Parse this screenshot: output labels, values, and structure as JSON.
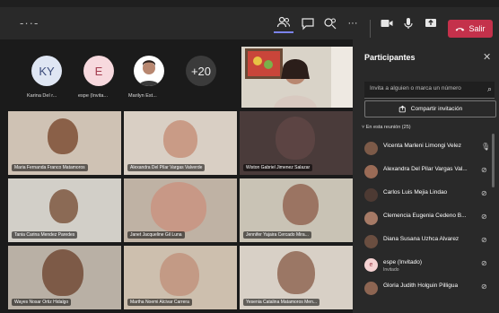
{
  "meeting": {
    "leave_label": "Salir",
    "topbar_more": "···"
  },
  "stage": {
    "avatars": [
      {
        "initials": "KY",
        "name": "Karina Del r...",
        "bg": "#dfe6f3",
        "fg": "#3b4b7a"
      },
      {
        "initials": "E",
        "name": "espe (Invita...",
        "bg": "#f7d9de",
        "fg": "#a33d4f"
      },
      {
        "initials": "",
        "name": "Marilyn Est...",
        "bg": "#ffffff",
        "fg": "#333"
      }
    ],
    "more_count": "+20",
    "tiles": [
      {
        "name": "Maria Fernanda Franco Matamoros",
        "bg": "#cfc2b4",
        "face": "#8a6048"
      },
      {
        "name": "Alexandra Del Pilar Vargas Valverde",
        "bg": "#d9cfc4",
        "face": "#c99b86"
      },
      {
        "name": "Wiston Gabriel Jimenez Salazar",
        "bg": "#4a3b3a",
        "face": "#5c4443"
      },
      {
        "name": "Tania Carina Mendez Paredes",
        "bg": "#d2cfc8",
        "face": "#8b6a55"
      },
      {
        "name": "Janet Jacqueline Gil Luna",
        "bg": "#bfb2a4",
        "face": "#c89886"
      },
      {
        "name": "Jennifer Yajaira Cercado Mira...",
        "bg": "#c9c3b5",
        "face": "#9b7462"
      },
      {
        "name": "Wayes Nosar Ortiz Hidalgo",
        "bg": "#b9b0a5",
        "face": "#7d5a47"
      },
      {
        "name": "Martha Noemi Alcivar Carrera",
        "bg": "#cdbfae",
        "face": "#c39a85"
      },
      {
        "name": "Yesenia Catalina Matamoros Men...",
        "bg": "#d8d0c6",
        "face": "#9b7765"
      }
    ]
  },
  "panel": {
    "title": "Participantes",
    "search_placeholder": "Invita a alguien o marca un número",
    "share_label": "Compartir invitación",
    "section_label": "En esta reunión (25)",
    "participants": [
      {
        "name": "Vicenta Marleni Limongi Velez",
        "sub": "",
        "initial": "",
        "mic": "on"
      },
      {
        "name": "Alexandra Del Pilar Vargas Val...",
        "sub": "",
        "initial": "",
        "mic": "off"
      },
      {
        "name": "Carlos Luis Mejia Lindao",
        "sub": "",
        "initial": "",
        "mic": "off"
      },
      {
        "name": "Clemencia Eugenia Cedeno B...",
        "sub": "",
        "initial": "",
        "mic": "off"
      },
      {
        "name": "Diana Susana Uzhca Alvarez",
        "sub": "",
        "initial": "",
        "mic": "off"
      },
      {
        "name": "espe (Invitado)",
        "sub": "Invitado",
        "initial": "e",
        "mic": "off"
      },
      {
        "name": "Gloria Judith Holguin Pilligua",
        "sub": "",
        "initial": "",
        "mic": "off"
      }
    ]
  }
}
